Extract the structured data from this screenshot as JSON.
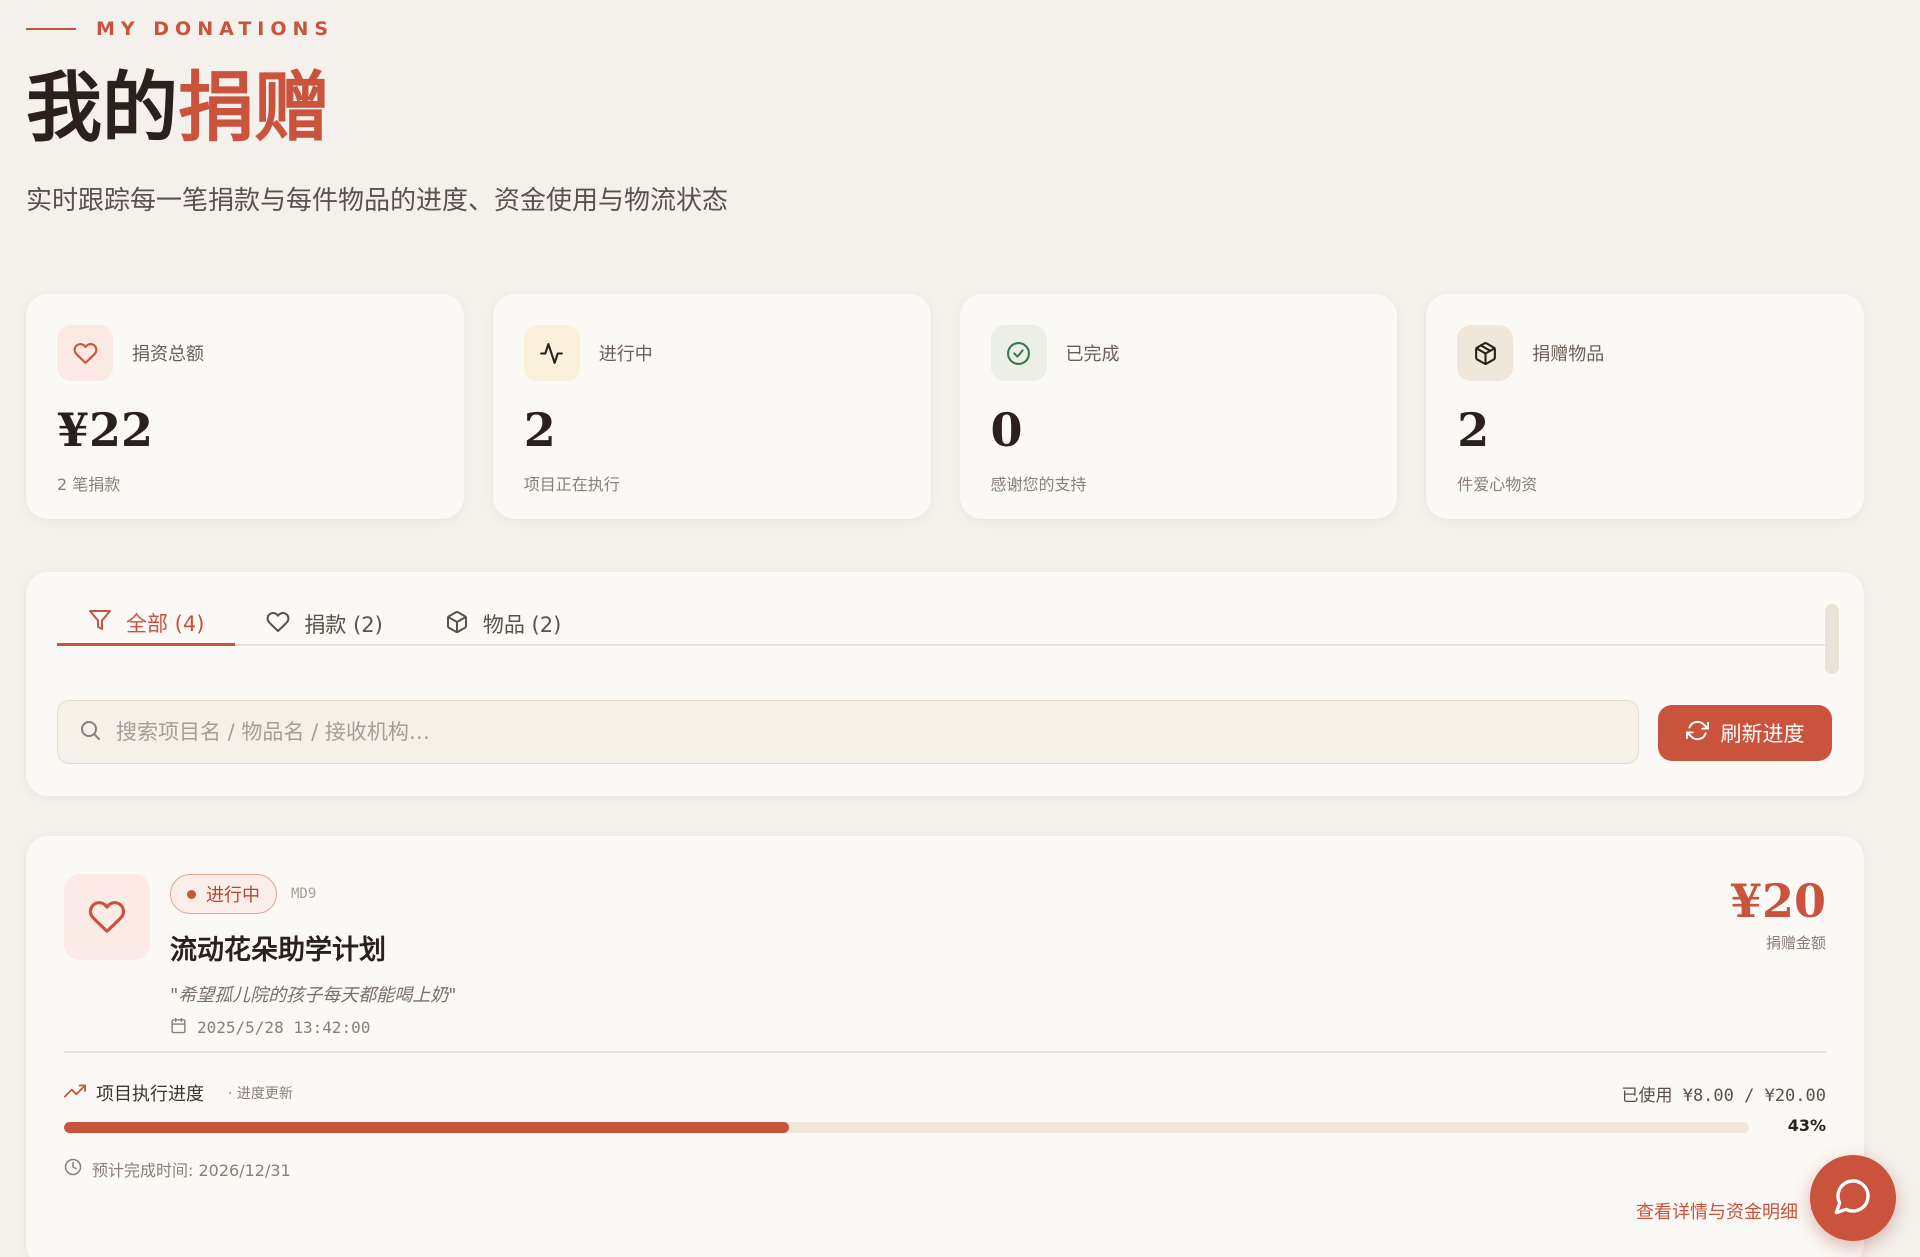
{
  "header": {
    "eyebrow": "MY DONATIONS",
    "title_main": "我的",
    "title_accent": "捐赠",
    "subtitle": "实时跟踪每一笔捐款与每件物品的进度、资金使用与物流状态"
  },
  "stats": [
    {
      "label": "捐资总额",
      "value": "¥22",
      "sub": "2 笔捐款",
      "icon": "heart-icon",
      "icon_color": "#c9533d",
      "icon_bg": "#fbe9e3"
    },
    {
      "label": "进行中",
      "value": "2",
      "sub": "项目正在执行",
      "icon": "activity-icon",
      "icon_color": "#2a211c",
      "icon_bg": "#fbf0d9"
    },
    {
      "label": "已完成",
      "value": "0",
      "sub": "感谢您的支持",
      "icon": "check-circle-icon",
      "icon_color": "#3a7a48",
      "icon_bg": "#ebefe6"
    },
    {
      "label": "捐赠物品",
      "value": "2",
      "sub": "件爱心物资",
      "icon": "package-icon",
      "icon_color": "#2a211c",
      "icon_bg": "#f1e6da"
    }
  ],
  "filters": {
    "tabs": [
      {
        "label": "全部 (4)",
        "icon": "filter-icon",
        "active": true
      },
      {
        "label": "捐款 (2)",
        "icon": "heart-icon",
        "active": false
      },
      {
        "label": "物品 (2)",
        "icon": "package-icon",
        "active": false
      }
    ],
    "search_placeholder": "搜索项目名 / 物品名 / 接收机构…",
    "refresh_label": "刷新进度"
  },
  "donation": {
    "status": "进行中",
    "code": "MD9",
    "title": "流动花朵助学计划",
    "quote": "\"希望孤儿院的孩子每天都能喝上奶\"",
    "date": "2025/5/28 13:42:00",
    "amount": "¥20",
    "amount_label": "捐赠金额",
    "progress_title": "项目执行进度",
    "progress_update": "· 进度更新",
    "used_text": "已使用 ¥8.00 / ¥20.00",
    "progress_percent": 43,
    "progress_label": "43%",
    "eta": "预计完成时间: 2026/12/31",
    "detail_link": "查看详情与资金明细"
  },
  "colors": {
    "accent": "#c9533d",
    "background": "#f4f1ec",
    "card": "#fbf9f5"
  }
}
